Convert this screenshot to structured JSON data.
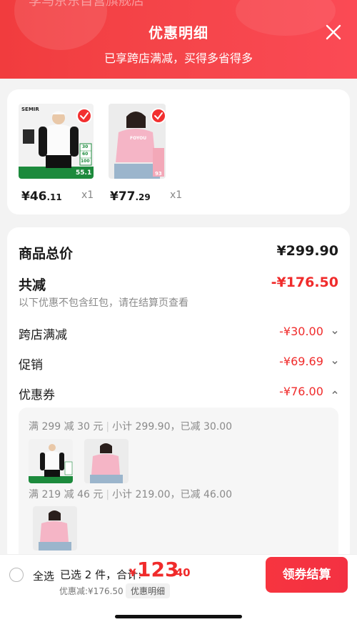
{
  "background_store_name": "李马京东自营旗舰店",
  "header": {
    "title": "优惠明细",
    "subtitle": "已享跨店满减，买得多省得多",
    "close_icon": "close-icon"
  },
  "products": [
    {
      "price_int": "¥46",
      "price_dec": ".11",
      "qty": "x1",
      "thumb_text": {
        "brand": "SEMIR",
        "labels": [
          "30",
          "60",
          "100"
        ],
        "price": "55.1"
      }
    },
    {
      "price_int": "¥77",
      "price_dec": ".29",
      "qty": "x1",
      "thumb_text": {
        "brand": "FOYOU",
        "price": "93"
      }
    }
  ],
  "summary": {
    "total_label": "商品总价",
    "total_value": "¥299.90",
    "reduction_label": "共减",
    "reduction_value": "-¥176.50",
    "note": "以下优惠不包含红包，请在结算页查看",
    "rows": [
      {
        "label": "跨店满减",
        "value": "-¥30.00",
        "icon": "chevron-down-icon"
      },
      {
        "label": "促销",
        "value": "-¥69.69",
        "icon": "chevron-down-icon"
      },
      {
        "label": "优惠券",
        "value": "-¥76.00",
        "icon": "chevron-up-icon"
      }
    ]
  },
  "coupon_groups": [
    {
      "rule": "满 299 减 30 元",
      "subtotal": "小计 299.90，已减 30.00"
    },
    {
      "rule": "满 219 减 46 元",
      "subtotal": "小计 219.00，已减 46.00"
    }
  ],
  "bottom_bar": {
    "select_all": "全选",
    "selected": "已选 2 件，合计:",
    "currency": "¥",
    "total_int": "123",
    "total_dec": ".40",
    "discount": "优惠减:¥176.50",
    "detail_link": "优惠明细",
    "checkout": "领券结算"
  },
  "colors": {
    "accent": "#f23030",
    "header": "#f4434a",
    "price_red": "#f02b2b"
  }
}
